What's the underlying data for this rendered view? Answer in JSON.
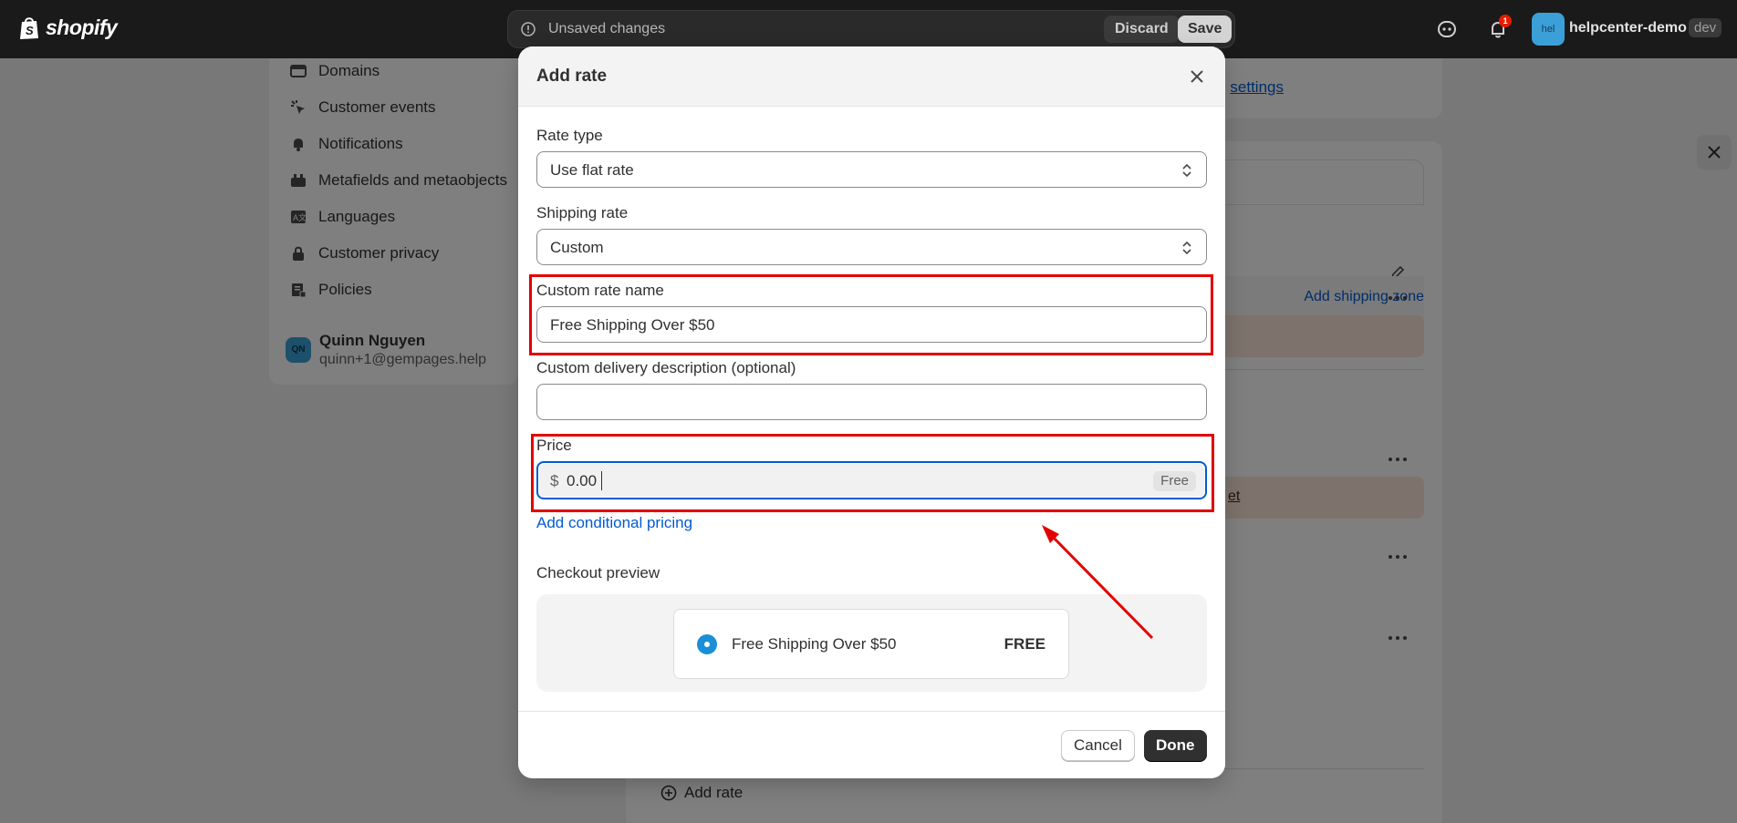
{
  "topbar": {
    "logo_text": "shopify",
    "unsaved_message": "Unsaved changes",
    "discard_label": "Discard",
    "save_label": "Save",
    "notification_count": "1",
    "store_avatar": "hel",
    "store_name": "helpcenter-demo",
    "store_badge": "dev"
  },
  "sidebar": {
    "items": [
      {
        "label": "Domains",
        "icon": "globe-icon"
      },
      {
        "label": "Customer events",
        "icon": "cursor-icon"
      },
      {
        "label": "Notifications",
        "icon": "bell-icon"
      },
      {
        "label": "Metafields and metaobjects",
        "icon": "metafields-icon"
      },
      {
        "label": "Languages",
        "icon": "translate-icon"
      },
      {
        "label": "Customer privacy",
        "icon": "lock-icon"
      },
      {
        "label": "Policies",
        "icon": "policy-icon"
      }
    ],
    "user": {
      "initials": "QN",
      "name": "Quinn Nguyen",
      "email": "quinn+1@gempages.help"
    }
  },
  "background": {
    "settings_link": "settings",
    "add_shipping_zone": "Add shipping zone",
    "orange_link": "et",
    "add_rate": "Add rate"
  },
  "modal": {
    "title": "Add rate",
    "rate_type": {
      "label": "Rate type",
      "value": "Use flat rate"
    },
    "shipping_rate": {
      "label": "Shipping rate",
      "value": "Custom"
    },
    "custom_rate_name": {
      "label": "Custom rate name",
      "value": "Free Shipping Over $50"
    },
    "custom_delivery_description": {
      "label": "Custom delivery description (optional)",
      "value": ""
    },
    "price": {
      "label": "Price",
      "currency": "$",
      "value": "0.00",
      "tag": "Free"
    },
    "conditional_link": "Add conditional pricing",
    "checkout_preview": {
      "label": "Checkout preview",
      "rate_name": "Free Shipping Over $50",
      "rate_price": "FREE"
    },
    "cancel_label": "Cancel",
    "done_label": "Done"
  },
  "colors": {
    "accent": "#005bd3",
    "annotation": "#e30000",
    "topbar": "#1a1a1a"
  }
}
